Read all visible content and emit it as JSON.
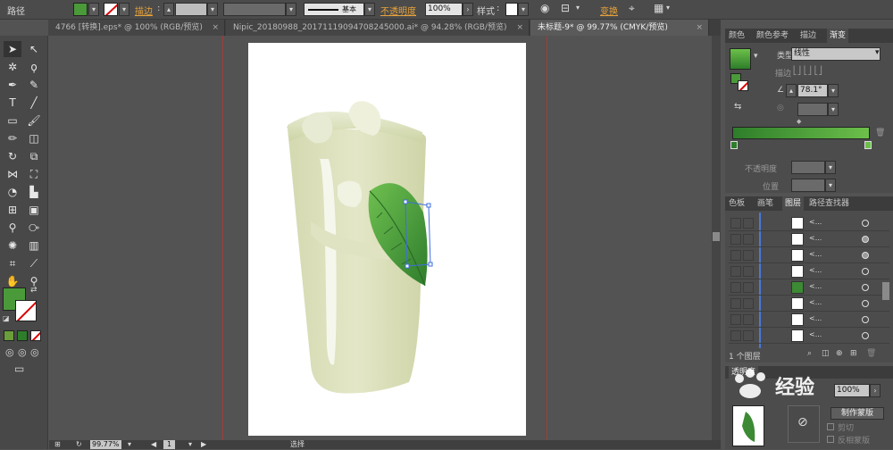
{
  "control_bar": {
    "object_type": "路径",
    "stroke_label": "描边",
    "stroke_value": "",
    "profile_label": "基本",
    "opacity_label": "不透明度",
    "opacity_value": "100%",
    "style_label": "样式",
    "transform_label": "变换",
    "fill_color": "#4a9a3a"
  },
  "tabs": [
    {
      "label": "4766 [转换].eps* @ 100% (RGB/预览)",
      "close": "×"
    },
    {
      "label": "Nipic_20180988_20171119094708245000.ai* @ 94.28% (RGB/预览)",
      "close": "×"
    },
    {
      "label": "未标题-9* @ 99.77% (CMYK/预览)",
      "close": "×"
    }
  ],
  "status_bar": {
    "zoom": "99.77%",
    "page": "1",
    "tool": "选择"
  },
  "gradient_panel": {
    "tabs": [
      "颜色",
      "颜色参考",
      "描边",
      "渐变"
    ],
    "active_tab": "渐变",
    "type_label": "类型",
    "type_value": "线性",
    "stroke_label": "描边",
    "angle_value": "78.1°",
    "opacity_label": "不透明度",
    "position_label": "位置",
    "start_color": "#2e7d2a",
    "end_color": "#6cc04a"
  },
  "layers_panel": {
    "tabs": [
      "色板",
      "画笔",
      "图层",
      "路径查找器"
    ],
    "active_tab": "图层",
    "rows": [
      {
        "name": "<...",
        "target_filled": false
      },
      {
        "name": "<...",
        "target_filled": true
      },
      {
        "name": "<...",
        "target_filled": true
      },
      {
        "name": "<...",
        "target_filled": false
      },
      {
        "name": "<...",
        "target_filled": false
      },
      {
        "name": "<...",
        "target_filled": false
      },
      {
        "name": "<...",
        "target_filled": false
      },
      {
        "name": "<...",
        "target_filled": false
      },
      {
        "name": "<...",
        "target_filled": false
      },
      {
        "name": "<...",
        "target_filled": false
      }
    ],
    "footer_count": "1 个图层"
  },
  "transparency_panel": {
    "tab": "透明度",
    "opacity_value": "100%",
    "make_mask_button": "制作蒙版",
    "clip_label": "剪切",
    "invert_label": "反相蒙版"
  },
  "watermark_text": "经验"
}
